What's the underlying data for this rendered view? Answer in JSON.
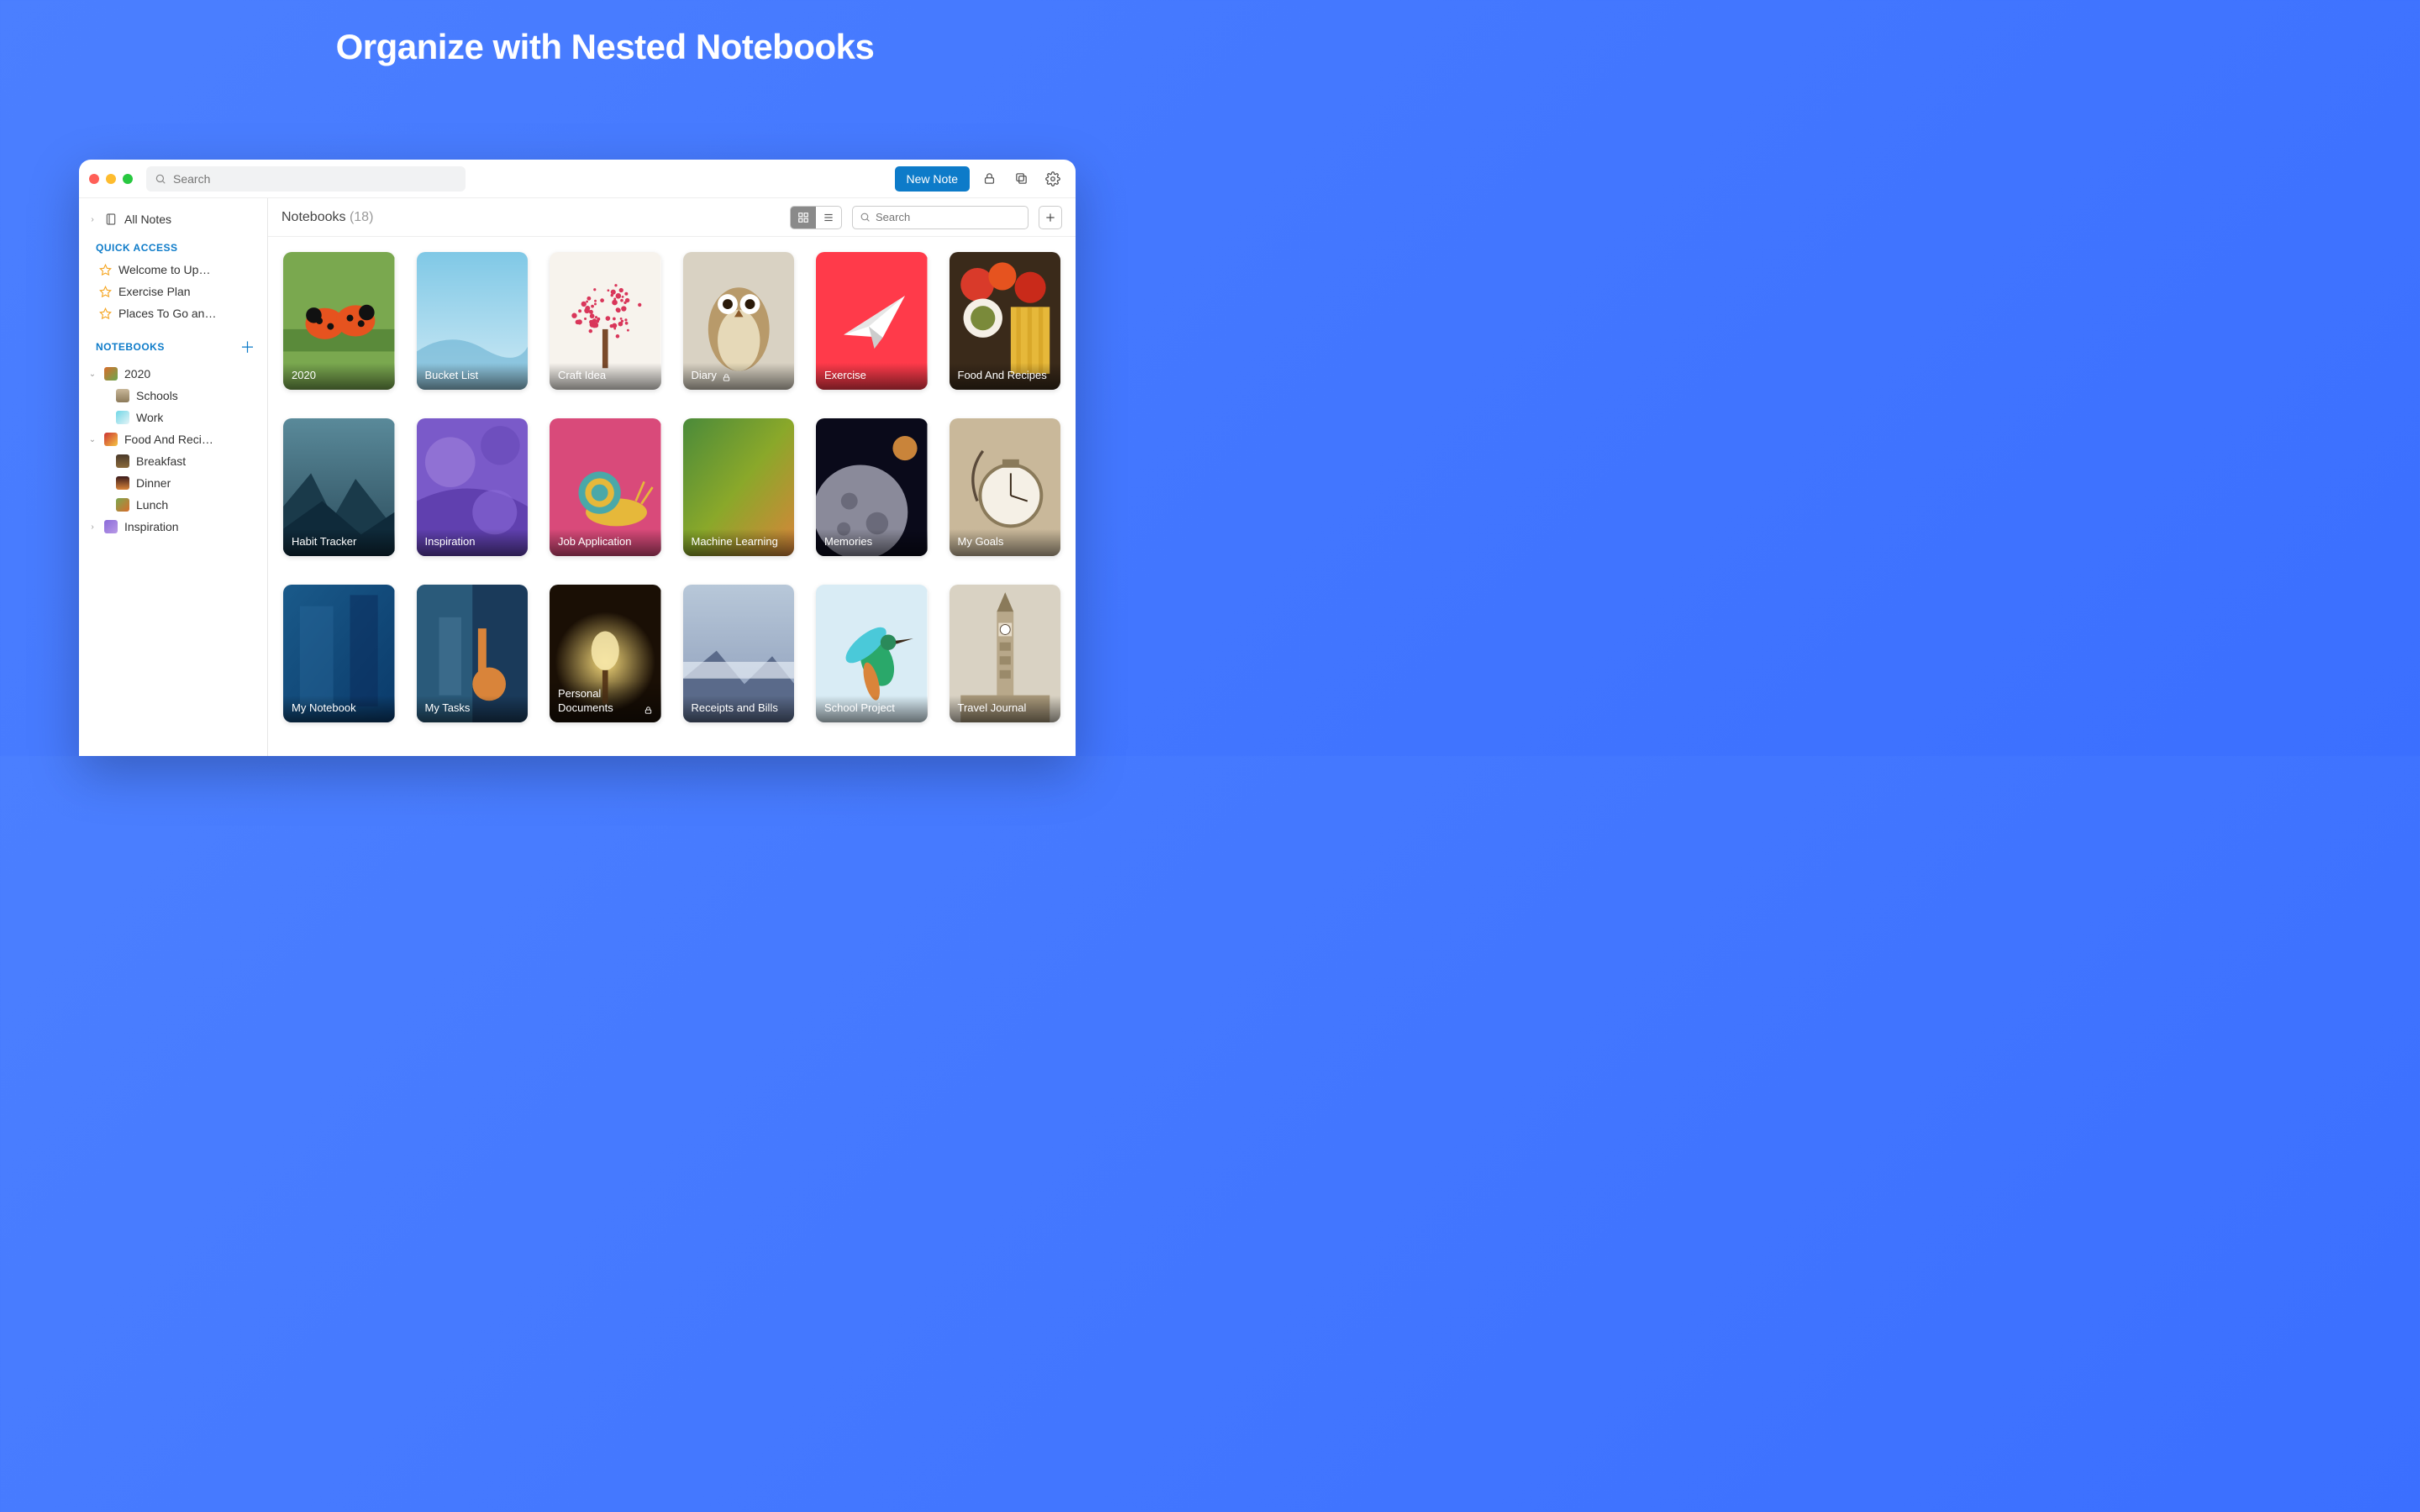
{
  "promo_title": "Organize with Nested Notebooks",
  "toolbar": {
    "search_placeholder": "Search",
    "new_note_label": "New Note"
  },
  "sidebar": {
    "all_notes_label": "All Notes",
    "quick_access_header": "QUICK ACCESS",
    "quick_access": [
      {
        "label": "Welcome to Up…"
      },
      {
        "label": "Exercise Plan"
      },
      {
        "label": "Places To Go an…"
      }
    ],
    "notebooks_header": "NOTEBOOKS",
    "tree": [
      {
        "label": "2020",
        "expanded": true,
        "thumb_bg": "linear-gradient(135deg,#d96c2b,#6aa84f)",
        "children": [
          {
            "label": "Schools",
            "thumb_bg": "linear-gradient(#c9b89a,#8c7a5a)"
          },
          {
            "label": "Work",
            "thumb_bg": "linear-gradient(135deg,#6fd6e6,#e6f4f7)"
          }
        ]
      },
      {
        "label": "Food And Reci…",
        "expanded": true,
        "thumb_bg": "linear-gradient(135deg,#c33,#f5c542)",
        "children": [
          {
            "label": "Breakfast",
            "thumb_bg": "linear-gradient(#4a3a2a,#8a6a3a)"
          },
          {
            "label": "Dinner",
            "thumb_bg": "linear-gradient(#3a1a1a,#d9843a)"
          },
          {
            "label": "Lunch",
            "thumb_bg": "linear-gradient(135deg,#7aa84f,#d96c2b)"
          }
        ]
      },
      {
        "label": "Inspiration",
        "expanded": false,
        "thumb_bg": "linear-gradient(135deg,#8a6ad9,#b99ae6)"
      }
    ]
  },
  "panel": {
    "title": "Notebooks",
    "count": "(18)",
    "search_placeholder": "Search",
    "view": "grid"
  },
  "notebooks": [
    {
      "title": "2020",
      "locked": false,
      "cover": {
        "type": "ladybugs"
      }
    },
    {
      "title": "Bucket List",
      "locked": false,
      "cover": {
        "type": "sky"
      }
    },
    {
      "title": "Craft Idea",
      "locked": false,
      "cover": {
        "type": "hearttree"
      }
    },
    {
      "title": "Diary",
      "locked": true,
      "cover": {
        "type": "owl"
      }
    },
    {
      "title": "Exercise",
      "locked": false,
      "cover": {
        "type": "paperplane"
      }
    },
    {
      "title": "Food And Recipes",
      "locked": false,
      "cover": {
        "type": "food"
      }
    },
    {
      "title": "Habit Tracker",
      "locked": false,
      "cover": {
        "type": "mountains"
      }
    },
    {
      "title": "Inspiration",
      "locked": false,
      "cover": {
        "type": "purple"
      }
    },
    {
      "title": "Job Application",
      "locked": false,
      "cover": {
        "type": "snail"
      }
    },
    {
      "title": "Machine Learning",
      "locked": false,
      "cover": {
        "type": "gradient-gy"
      }
    },
    {
      "title": "Memories",
      "locked": false,
      "cover": {
        "type": "moon"
      }
    },
    {
      "title": "My Goals",
      "locked": false,
      "cover": {
        "type": "clock"
      }
    },
    {
      "title": "My Notebook",
      "locked": false,
      "cover": {
        "type": "blue"
      }
    },
    {
      "title": "My Tasks",
      "locked": false,
      "cover": {
        "type": "abstract"
      }
    },
    {
      "title": "Personal Documents",
      "locked": true,
      "cover": {
        "type": "lamp"
      }
    },
    {
      "title": "Receipts and Bills",
      "locked": false,
      "cover": {
        "type": "mist-mountain"
      }
    },
    {
      "title": "School Project",
      "locked": false,
      "cover": {
        "type": "hummingbird"
      }
    },
    {
      "title": "Travel Journal",
      "locked": false,
      "cover": {
        "type": "bigben"
      }
    }
  ],
  "icons": {
    "search": "search-icon",
    "lock": "lock-icon",
    "copy": "copy-icon",
    "gear": "gear-icon",
    "grid": "grid-icon",
    "list": "list-icon",
    "plus": "plus-icon",
    "star": "star-icon",
    "notebook": "notebook-icon",
    "chevron-right": "chevron-right-icon",
    "chevron-down": "chevron-down-icon"
  }
}
